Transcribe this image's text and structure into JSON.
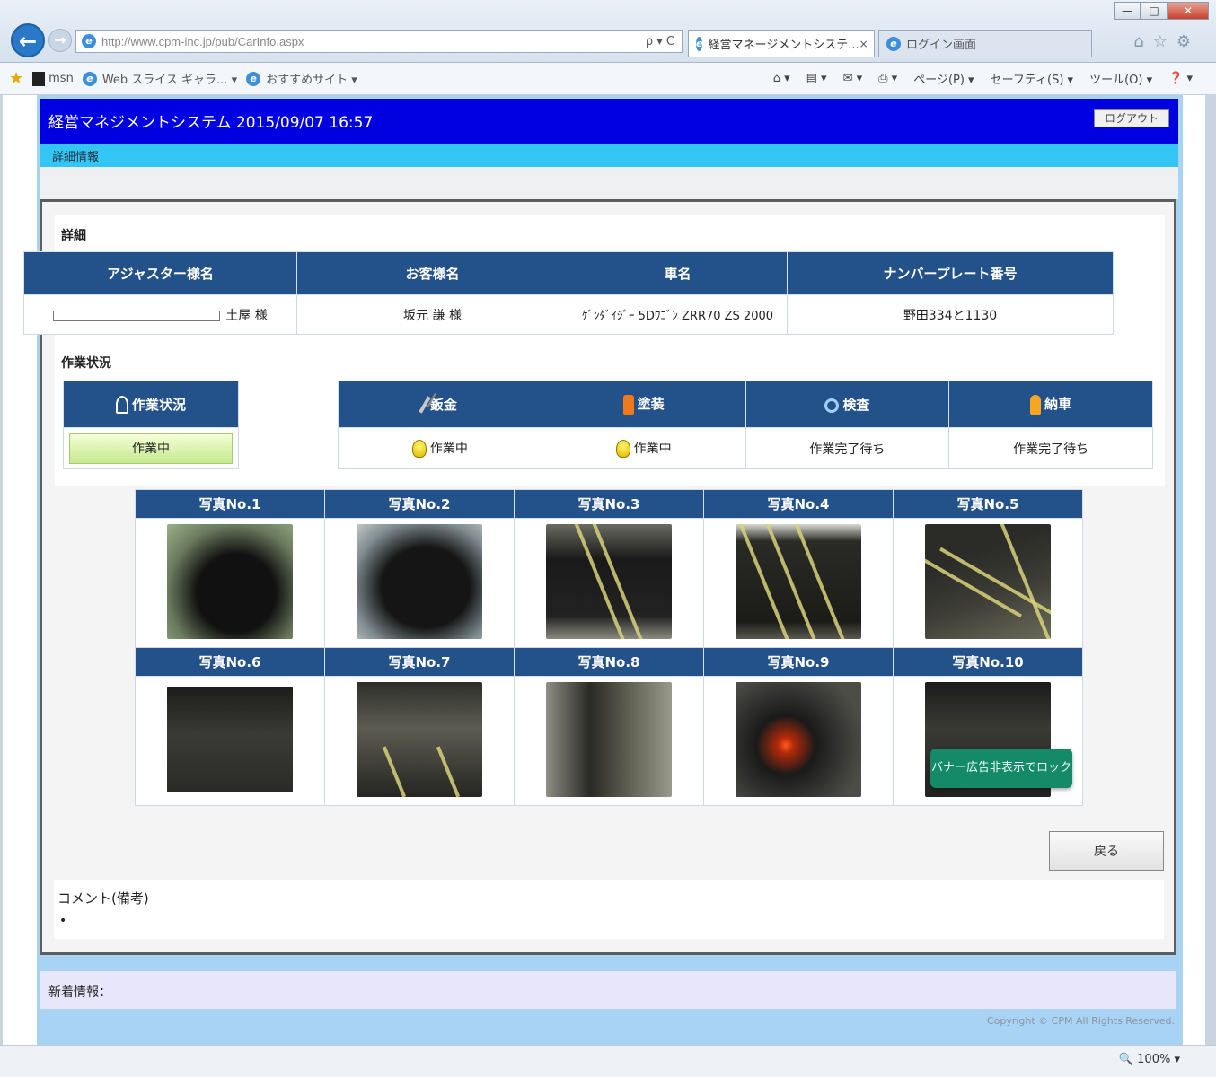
{
  "browser": {
    "url": "http://www.cpm-inc.jp/pub/CarInfo.aspx",
    "address_tools": "ρ ▾ C",
    "tabs": [
      {
        "label": "経営マネージメントシステ...",
        "active": true
      },
      {
        "label": "ログイン画面",
        "active": false
      }
    ],
    "favorites": [
      {
        "label": "msn"
      },
      {
        "label": "Web スライス ギャラ... ▾"
      },
      {
        "label": "おすすめサイト ▾"
      }
    ],
    "commands": [
      "ページ(P) ▾",
      "セーフティ(S) ▾",
      "ツール(O) ▾"
    ],
    "zoom": "100%",
    "window_buttons": [
      "—",
      "□",
      "✕"
    ]
  },
  "app": {
    "title": "経営マネジメントシステム 2015/09/07 16:57",
    "logout_label": "ログアウト",
    "subnav_label": "詳細情報"
  },
  "details": {
    "section_label": "詳細",
    "headers": [
      "アジャスター様名",
      "お客様名",
      "車名",
      "ナンバープレート番号"
    ],
    "values": [
      "土屋 様",
      "坂元 謙 様",
      "ｹﾞﾝﾀﾞｲｼﾞｰ 5Dﾜｺﾞﾝ ZRR70 ZS 2000",
      "野田334と1130"
    ]
  },
  "work_status": {
    "section_label": "作業状況",
    "header": "作業状況",
    "value": "作業中"
  },
  "process": {
    "headers": [
      "鈑金",
      "塗装",
      "検査",
      "納車"
    ],
    "values": [
      "作業中",
      "作業中",
      "作業完了待ち",
      "作業完了待ち"
    ],
    "icons": [
      "hammer-icon",
      "spray-icon",
      "magnifier-icon",
      "person-icon"
    ]
  },
  "photos": {
    "labels": [
      "写真No.1",
      "写真No.2",
      "写真No.3",
      "写真No.4",
      "写真No.5",
      "写真No.6",
      "写真No.7",
      "写真No.8",
      "写真No.9",
      "写真No.10"
    ]
  },
  "back_button_label": "戻る",
  "banner_lock_label": "バナー広告非表示でロック",
  "comment": {
    "label": "コメント(備考)",
    "value": "•"
  },
  "news_label": "新着情報：",
  "copyright": "Copyright © CPM All Rights Reserved."
}
